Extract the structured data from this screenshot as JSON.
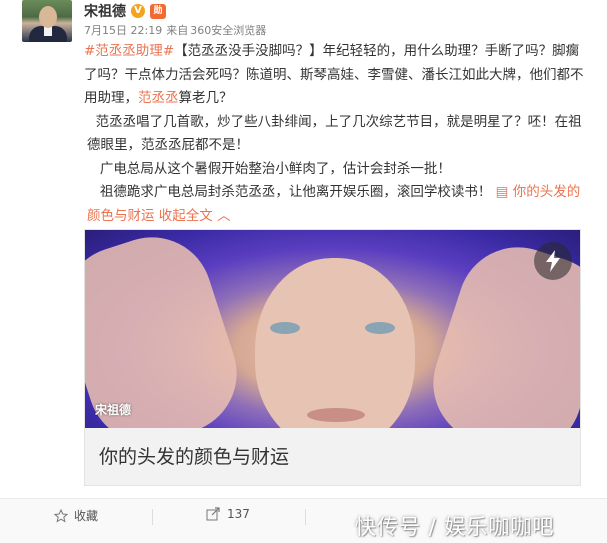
{
  "post": {
    "author": "宋祖德",
    "badges": {
      "verified": "V",
      "medal": "勋"
    },
    "meta": {
      "date": "7月15日 22:19",
      "from": "来自",
      "client": "360安全浏览器"
    },
    "text": {
      "hashtag": "#范丞丞助理#",
      "line1_rest": "【范丞丞没手没脚吗？】年纪轻轻的，用什么助理？手断了吗？脚瘸了吗？干点体力活会死吗？陈道明、斯琴高娃、李雪健、潘长江如此大牌，他们都不用助理，",
      "mention1": "范丞丞",
      "line1_end": "算老几？",
      "para2": "范丞丞唱了几首歌，炒了些八卦绯闻，上了几次综艺节目，就是明星了？呸！在祖德眼里，范丞丞屁都不是！",
      "para3": "广电总局从这个暑假开始整治小鲜肉了，估计会封杀一批！",
      "para4": "祖德跪求广电总局封杀范丞丞，让他离开娱乐圈，滚回学校读书！",
      "link_icon": "▤",
      "link_text": "你的头发的颜色与财运",
      "collapse": "收起全文",
      "collapse_icon": "︿"
    },
    "card": {
      "badge": "宋祖德",
      "title": "你的头发的颜色与财运"
    }
  },
  "actions": {
    "favorite": "收藏",
    "forward_count": "137"
  },
  "watermark": "快传号 / 娱乐咖咖吧"
}
